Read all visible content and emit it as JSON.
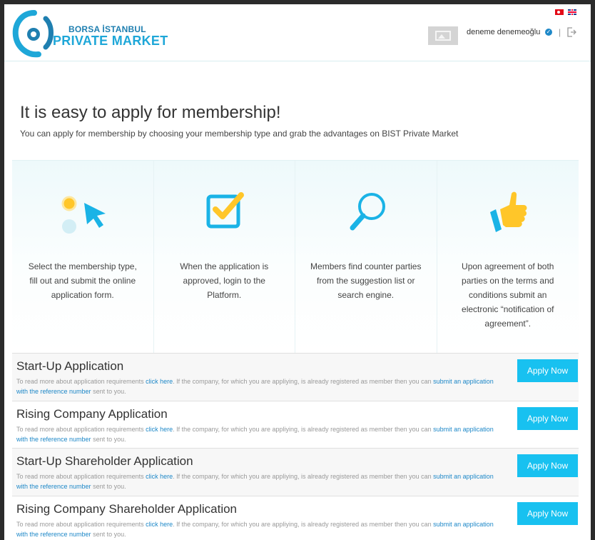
{
  "header": {
    "logo_top": "BORSA İSTANBUL",
    "logo_main": "PRIVATE MARKET",
    "username": "deneme denemeoğlu",
    "separator": "|",
    "flags": [
      "flag-tr-icon",
      "flag-en-icon"
    ]
  },
  "hero": {
    "title": "It is easy to apply for membership!",
    "subtitle": "You can apply for membership by choosing your membership type and grab the advantages on BIST Private Market"
  },
  "steps": [
    {
      "icon": "cursor-click-icon",
      "text": "Select the membership type, fill out and submit the online application form."
    },
    {
      "icon": "checkbox-icon",
      "text": "When the application is approved, login to the Platform."
    },
    {
      "icon": "search-icon",
      "text": "Members find counter parties from the suggestion list or search engine."
    },
    {
      "icon": "thumbs-up-icon",
      "text": "Upon agreement of both parties on the terms and conditions submit an electronic “notification of agreement”."
    }
  ],
  "applications": [
    {
      "title": "Start-Up Application",
      "button": "Apply Now"
    },
    {
      "title": "Rising Company Application",
      "button": "Apply Now"
    },
    {
      "title": "Start-Up Shareholder Application",
      "button": "Apply Now"
    },
    {
      "title": "Rising Company Shareholder Application",
      "button": "Apply Now"
    }
  ],
  "app_desc": {
    "part1": "To read more about application requirements ",
    "link1": "click here",
    "part2": ". If the company, for which you are appliying, is already registered as member then you can  ",
    "link2": "submit an application with the reference number",
    "part3": " sent to you."
  },
  "colors": {
    "accent": "#18c1f0",
    "brand": "#1ea7d8",
    "link": "#1e88c8",
    "icon_yellow": "#ffc629"
  }
}
